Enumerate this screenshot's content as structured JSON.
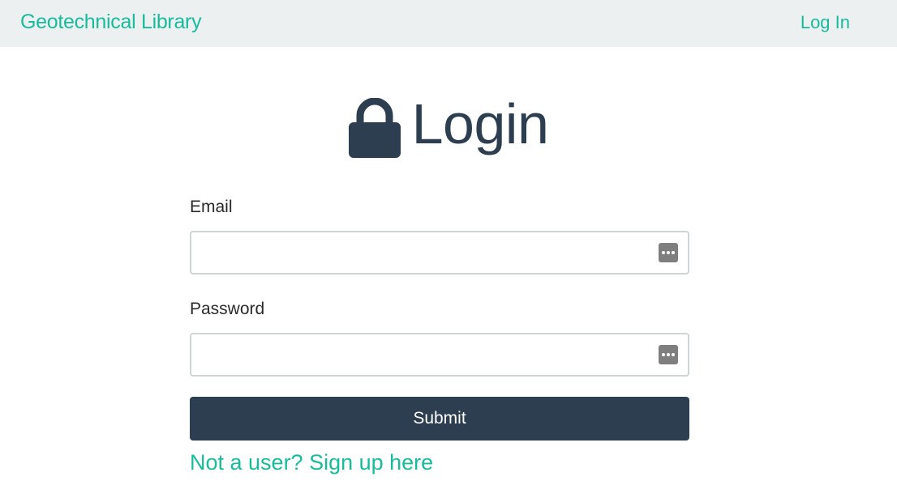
{
  "navbar": {
    "brand": "Geotechnical Library",
    "login_link": "Log In"
  },
  "page": {
    "heading": "Login",
    "heading_icon": "lock-icon"
  },
  "form": {
    "email_label": "Email",
    "email_value": "",
    "password_label": "Password",
    "password_value": "",
    "submit_label": "Submit",
    "signup_link": "Not a user? Sign up here"
  },
  "colors": {
    "accent": "#18bc9c",
    "primary": "#2c3e50",
    "navbar_bg": "#ecf0f1"
  }
}
